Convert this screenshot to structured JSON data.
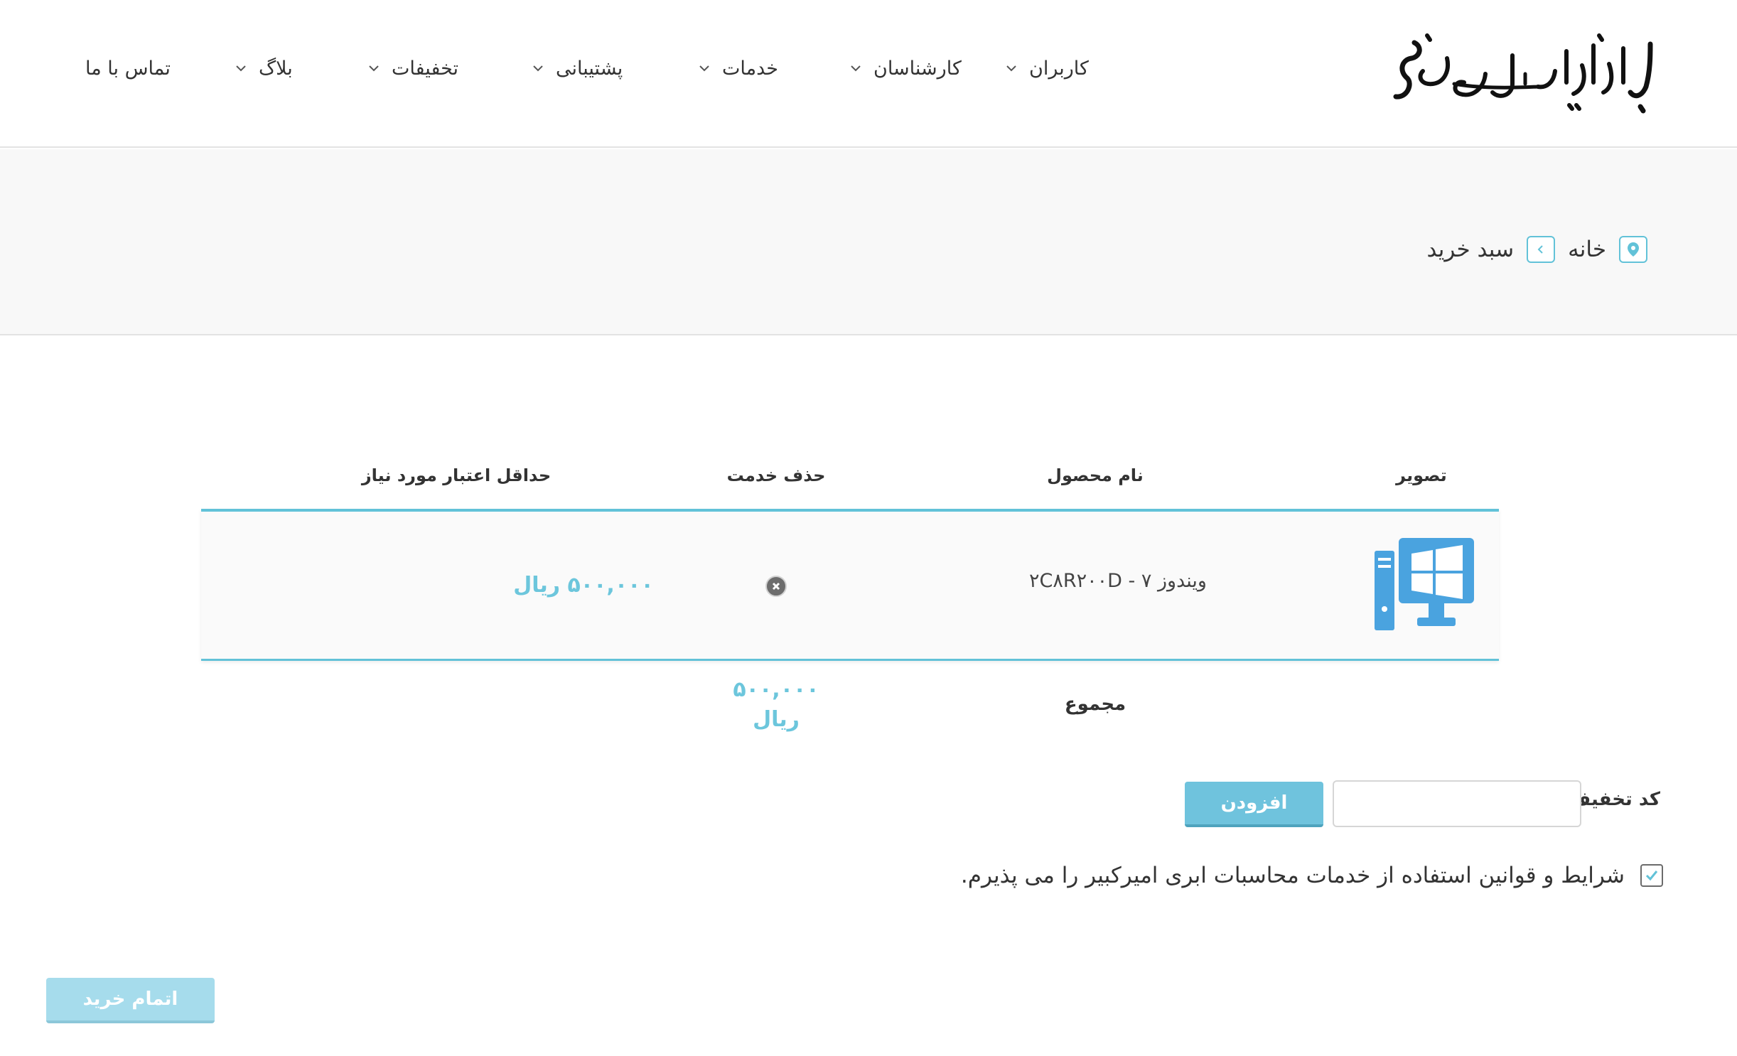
{
  "header": {
    "logo_text": "ابررایانه ملی سیمرغ",
    "nav": [
      {
        "label": "کاربران"
      },
      {
        "label": "کارشناسان"
      },
      {
        "label": "خدمات"
      },
      {
        "label": "پشتیبانی"
      },
      {
        "label": "تخفیفات"
      },
      {
        "label": "بلاگ"
      },
      {
        "label": "تماس با ما"
      }
    ]
  },
  "breadcrumb": {
    "home": "خانه",
    "current": "سبد خرید"
  },
  "cart": {
    "columns": {
      "image": "تصویر",
      "product_name": "نام محصول",
      "remove": "حذف خدمت",
      "min_credit": "حداقل اعتبار مورد نیاز"
    },
    "items": [
      {
        "icon": "desktop-computer-icon",
        "product_name": "ویندوز ۷ - ۲C۸R۲۰۰D",
        "price": "۵۰۰,۰۰۰ ریال"
      }
    ],
    "total_label": "مجموع",
    "total_amount": "۵۰۰,۰۰۰",
    "total_currency": "ریال"
  },
  "discount": {
    "label": "کد تخفیف",
    "value": "",
    "add_label": "افزودن"
  },
  "terms": {
    "checked": true,
    "text": "شرایط و قوانین استفاده از خدمات محاسبات ابری امیرکبیر را می پذیرم."
  },
  "checkout": {
    "label": "اتمام خرید"
  },
  "colors": {
    "accent": "#62c2d8",
    "price": "#6cc6dc",
    "icon_blue": "#4aa3df"
  }
}
